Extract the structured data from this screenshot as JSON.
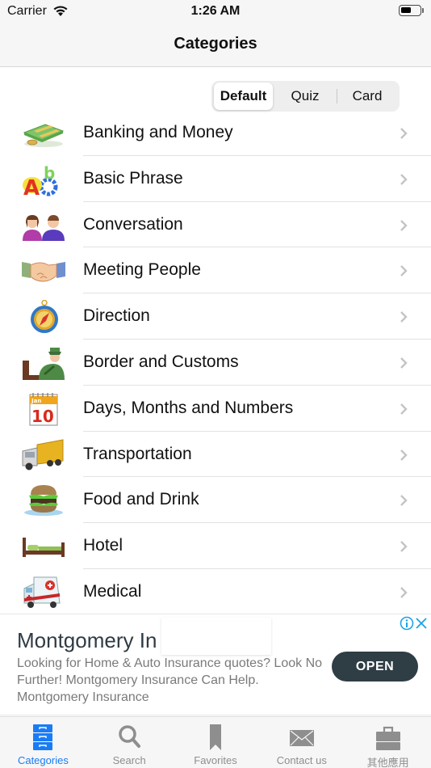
{
  "status_bar": {
    "carrier": "Carrier",
    "time": "1:26 AM",
    "wifi_icon": "wifi-icon",
    "battery_icon": "battery-icon"
  },
  "nav": {
    "title": "Categories"
  },
  "segmented": {
    "options": [
      "Default",
      "Quiz",
      "Card"
    ],
    "selected": "Default"
  },
  "categories": [
    {
      "label": "Banking and Money",
      "icon": "money-icon"
    },
    {
      "label": "Basic Phrase",
      "icon": "abc-letters-icon"
    },
    {
      "label": "Conversation",
      "icon": "people-icon"
    },
    {
      "label": "Meeting People",
      "icon": "handshake-icon"
    },
    {
      "label": "Direction",
      "icon": "compass-icon"
    },
    {
      "label": "Border and Customs",
      "icon": "customs-officer-icon"
    },
    {
      "label": "Days, Months and Numbers",
      "icon": "calendar-icon"
    },
    {
      "label": "Transportation",
      "icon": "truck-icon"
    },
    {
      "label": "Food and Drink",
      "icon": "burger-icon"
    },
    {
      "label": "Hotel",
      "icon": "bed-icon"
    },
    {
      "label": "Medical",
      "icon": "ambulance-icon"
    }
  ],
  "calendar_icon": {
    "month": "Jan",
    "day": "10"
  },
  "ad": {
    "title": "Montgomery In",
    "body": "Looking for Home & Auto Insurance quotes? Look No Further! Montgomery Insurance Can Help. Montgomery Insurance",
    "cta": "OPEN"
  },
  "tabs": [
    {
      "label": "Categories",
      "icon": "drawers-icon",
      "active": true
    },
    {
      "label": "Search",
      "icon": "search-icon",
      "active": false
    },
    {
      "label": "Favorites",
      "icon": "bookmark-icon",
      "active": false
    },
    {
      "label": "Contact us",
      "icon": "mail-icon",
      "active": false
    },
    {
      "label": "其他應用",
      "icon": "briefcase-icon",
      "active": false
    }
  ],
  "colors": {
    "accent": "#1a7cf5",
    "inactive": "#8e8e8e",
    "ad_button": "#2f3d45"
  }
}
